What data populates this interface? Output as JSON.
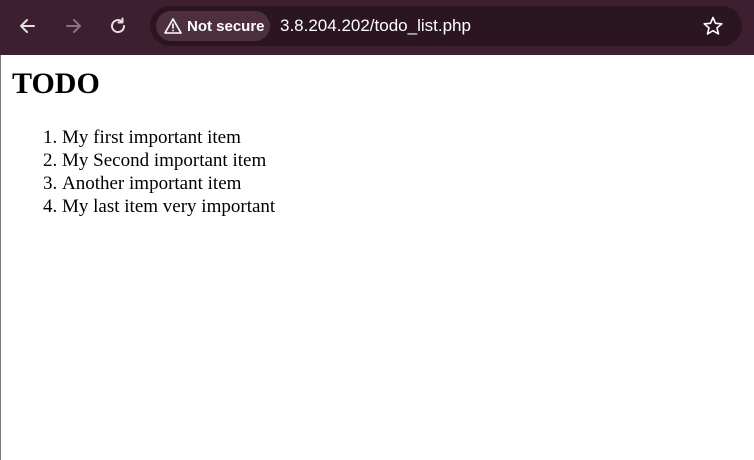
{
  "browser": {
    "back_icon": "arrow-left-icon",
    "forward_icon": "arrow-right-icon",
    "reload_icon": "reload-icon",
    "security_label": "Not secure",
    "url": "3.8.204.202/todo_list.php",
    "bookmark_icon": "star-icon",
    "toolbar_color": "#3d1f2f"
  },
  "page": {
    "title": "TODO",
    "items": [
      "My first important item",
      "My Second important item",
      "Another important item",
      "My last item very important"
    ]
  }
}
